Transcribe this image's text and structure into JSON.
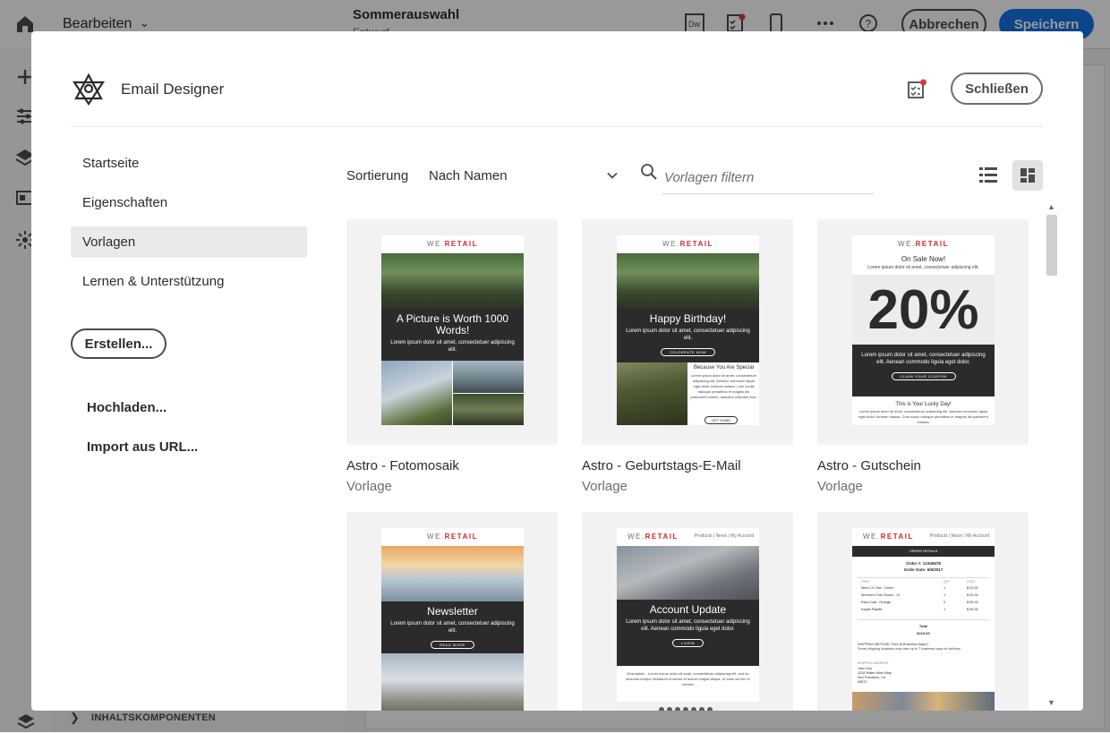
{
  "app": {
    "edit_menu": "Bearbeiten",
    "doc_title": "Sommerauswahl",
    "doc_status": "Entwurf",
    "cancel_label": "Abbrechen",
    "save_label": "Speichern",
    "bottom_panel_label": "INHALTSKOMPONENTEN"
  },
  "dialog": {
    "title": "Email Designer",
    "close_label": "Schließen",
    "nav": [
      {
        "label": "Startseite",
        "active": false
      },
      {
        "label": "Eigenschaften",
        "active": false
      },
      {
        "label": "Vorlagen",
        "active": true
      },
      {
        "label": "Lernen & Unterstützung",
        "active": false
      }
    ],
    "create_label": "Erstellen...",
    "actions": [
      "Hochladen...",
      "Import aus URL..."
    ],
    "toolbar": {
      "sort_label": "Sortierung",
      "sort_value": "Nach Namen",
      "search_placeholder": "Vorlagen filtern"
    },
    "templates": [
      {
        "name": "Astro - Fotomosaik",
        "type": "Vorlage",
        "preview": {
          "brand_a": "WE.",
          "brand_b": "RETAIL",
          "heading": "A Picture is Worth 1000 Words!",
          "body": "Lorem ipsum dolor sit amet, consectetuer adipiscing elit."
        }
      },
      {
        "name": "Astro - Geburtstags-E-Mail",
        "type": "Vorlage",
        "preview": {
          "brand_a": "WE.",
          "brand_b": "RETAIL",
          "heading": "Happy Birthday!",
          "body": "Lorem ipsum dolor sit amet, consectetuer adipiscing elit.",
          "button": "CELEBRATE NOW",
          "sub_heading": "Because You Are Special",
          "sub_body": "Lorem ipsum dolor sit amet, consectetuer adipiscing elit. Aenean commodo ligula eget dolor. Aenean massa. Cum sociis natoque penatibus et magnis dis parturient montes, nascetur ridiculus mus.",
          "sub_button": "GET SOME"
        }
      },
      {
        "name": "Astro - Gutschein",
        "type": "Vorlage",
        "preview": {
          "brand_a": "WE.",
          "brand_b": "RETAIL",
          "top_heading": "On Sale Now!",
          "top_body": "Lorem ipsum dolor sit amet, consectetuer adipiscing elit.",
          "big": "20%",
          "body": "Lorem ipsum dolor sit amet, consectetuer adipiscing elit. Aenean commodo ligula eget dolor.",
          "button": "CLAIM YOUR COUPON",
          "footer_heading": "This is Your Lucky Day!",
          "footer_body": "Lorem ipsum dolor sit amet, consectetuer adipiscing elit. Aenean commodo ligula eget dolor. Aenean massa. Cum sociis natoque penatibus et magnis dis parturient montes."
        }
      },
      {
        "preview": {
          "brand_a": "WE.",
          "brand_b": "RETAIL",
          "heading": "Newsletter",
          "body": "Lorem ipsum dolor sit amet, consectetuer adipiscing elit.",
          "button": "READ MORE"
        }
      },
      {
        "preview": {
          "brand_a": "WE.",
          "brand_b": "RETAIL",
          "nav": "Products  |  News  |  My Account",
          "heading": "Account Update",
          "body": "Lorem ipsum dolor sit amet, consectetuer adipiscing elit. Aenean commodo ligula eget dolor.",
          "button": "LOGIN",
          "desc": "Description - Lorem ipsum dolor sit amet, consectetuer adipiscing elit, sed do eiusmod tempor incididunt ut labore et dolore magna aliqua. Ut enim ad min m veniam"
        }
      },
      {
        "preview": {
          "brand_a": "WE.",
          "brand_b": "RETAIL",
          "nav": "Products  |  News  |  My Account",
          "band": "ORDER DETAILS",
          "order_no": "Order #: 12345678",
          "order_date": "Order Date: 6/6/2017",
          "cols": [
            "ITEM",
            "QTY",
            "COST"
          ],
          "rows": [
            [
              "Men's XL Hat - Green",
              "1",
              "$ 20.00"
            ],
            [
              "Women's Trek Shoes - 12",
              "1",
              "$ 40.00"
            ],
            [
              "Rain Coat - Orange",
              "2",
              "$ 40.00"
            ],
            [
              "Kayak Paddle",
              "1",
              "$ 50.00"
            ]
          ],
          "total_label": "Total",
          "total": "$210.00",
          "ship": "SHIPPING METHOD: Free (5 Business Days*)",
          "ship_note": "Some shipping locations may take up to 7 business days for delivery",
          "addr_label": "SHIPPING ADDRESS",
          "addr": [
            "John Doe",
            "1234 Water Word Way",
            "San Francisco, Ca",
            "45670"
          ]
        }
      }
    ]
  },
  "colors": {
    "accent": "#1473e6",
    "brand_red": "#d6262e",
    "notif_dot": "#d7373f"
  }
}
